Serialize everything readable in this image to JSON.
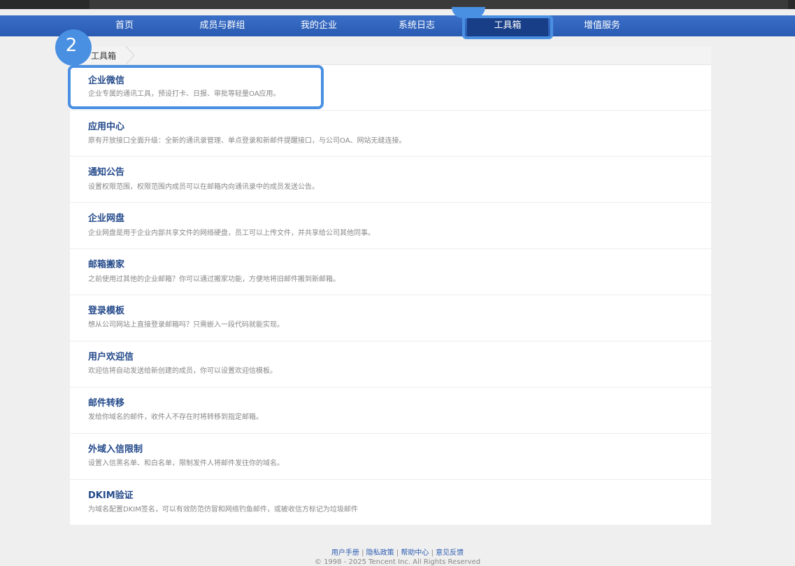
{
  "nav": {
    "items": [
      {
        "label": "首页"
      },
      {
        "label": "成员与群组"
      },
      {
        "label": "我的企业"
      },
      {
        "label": "系统日志"
      },
      {
        "label": "工具箱",
        "active": true
      },
      {
        "label": "增值服务"
      }
    ]
  },
  "annotation": {
    "step": "2"
  },
  "breadcrumb": {
    "label": "工具箱"
  },
  "tools": [
    {
      "title": "企业微信",
      "desc": "企业专属的通讯工具，预设打卡、日报、审批等轻量OA应用。"
    },
    {
      "title": "应用中心",
      "desc": "原有开放接口全面升级：全新的通讯录管理、单点登录和新邮件提醒接口，与公司OA、网站无缝连接。"
    },
    {
      "title": "通知公告",
      "desc": "设置权限范围，权限范围内成员可以在邮箱内向通讯录中的成员发送公告。"
    },
    {
      "title": "企业网盘",
      "desc": "企业网盘是用于企业内部共享文件的网络硬盘，员工可以上传文件，并共享给公司其他同事。"
    },
    {
      "title": "邮箱搬家",
      "desc": "之前使用过其他的企业邮箱？你可以通过搬家功能，方便地将旧邮件搬到新邮箱。"
    },
    {
      "title": "登录模板",
      "desc": "想从公司网站上直接登录邮箱吗？只需嵌入一段代码就能实现。"
    },
    {
      "title": "用户欢迎信",
      "desc": "欢迎信将自动发送给新创建的成员，你可以设置欢迎信模板。"
    },
    {
      "title": "邮件转移",
      "desc": "发给你域名的邮件，收件人不存在时将转移到指定邮箱。"
    },
    {
      "title": "外域入信限制",
      "desc": "设置入信黑名单、和白名单，限制发件人将邮件发往你的域名。"
    },
    {
      "title": "DKIM验证",
      "desc": "为域名配置DKIM签名，可以有效防范仿冒和网络钓鱼邮件，或被收信方标记为垃圾邮件"
    }
  ],
  "footer": {
    "links": [
      "用户手册",
      "隐私政策",
      "帮助中心",
      "意见反馈"
    ],
    "separator": "|",
    "copyright": "© 1998 - 2025 Tencent Inc. All Rights Reserved"
  },
  "colors": {
    "accent": "#4a90e2",
    "nav": "#2a5bb2",
    "title": "#244a8b"
  }
}
